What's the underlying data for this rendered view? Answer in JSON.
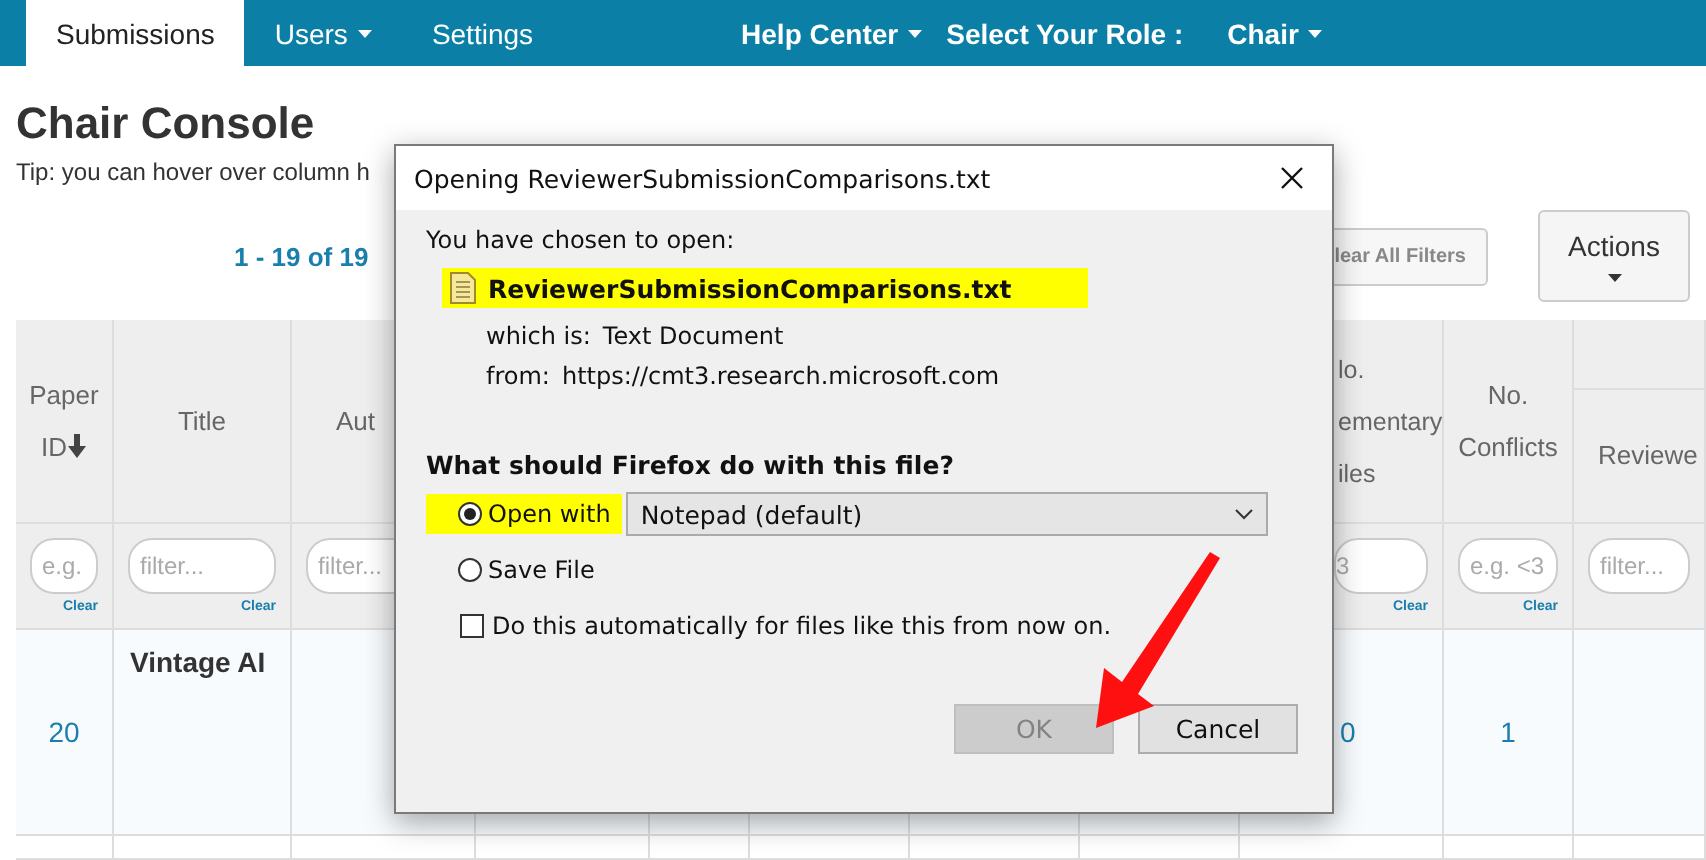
{
  "nav": {
    "items": [
      {
        "label": "Submissions",
        "selected": true,
        "dropdown": false
      },
      {
        "label": "Users",
        "selected": false,
        "dropdown": true
      },
      {
        "label": "Settings",
        "selected": false,
        "dropdown": false
      }
    ],
    "right_items": [
      {
        "label": "Help Center",
        "dropdown": true
      },
      {
        "label": "Select Your Role :",
        "dropdown": false
      },
      {
        "label": "Chair",
        "dropdown": true
      }
    ]
  },
  "page": {
    "title": "Chair Console",
    "tip": "Tip: you can hover over column h",
    "pagination": "1 - 19 of 19",
    "clear_filters_button": "lear All Filters",
    "actions_button": "Actions"
  },
  "table": {
    "columns": [
      {
        "header": [
          "Paper",
          "ID"
        ],
        "sorted": true,
        "filter": {
          "placeholder": "e.g.",
          "clear": "Clear"
        }
      },
      {
        "header": [
          "Title"
        ],
        "sorted": false,
        "filter": {
          "placeholder": "filter...",
          "clear": "Clear"
        }
      },
      {
        "header": [
          "Aut"
        ],
        "sorted": false,
        "filter": {
          "placeholder": "filter..."
        }
      },
      {
        "header": [
          "lo.",
          "ementary",
          "iles"
        ],
        "sorted": false,
        "filter": {
          "placeholder": "3",
          "clear": "Clear"
        }
      },
      {
        "header": [
          "No.",
          "Conflicts"
        ],
        "sorted": false,
        "filter": {
          "placeholder": "e.g. <3",
          "clear": "Clear"
        }
      },
      {
        "header": [
          "Reviewe"
        ],
        "sorted": false,
        "filter": {
          "placeholder": "filter..."
        }
      }
    ],
    "rows": [
      {
        "paper_id": "20",
        "title": "Vintage AI",
        "supplementary_files": "0",
        "conflicts": "1"
      }
    ]
  },
  "dialog": {
    "title": "Opening ReviewerSubmissionComparisons.txt",
    "intro": "You have chosen to open:",
    "file_name": "ReviewerSubmissionComparisons.txt",
    "file_highlighted": true,
    "type_label": "which is:",
    "type_value": "Text Document",
    "source_label": "from:",
    "source_value": "https://cmt3.research.microsoft.com",
    "question": "What should Firefox do with this file?",
    "options": [
      {
        "label": "Open with",
        "selected": true,
        "highlighted": true,
        "app": "Notepad (default)"
      },
      {
        "label": "Save File",
        "selected": false,
        "highlighted": false
      }
    ],
    "remember": {
      "label": "Do this automatically for files like this from now on.",
      "checked": false
    },
    "buttons": [
      {
        "label": "OK",
        "disabled": true
      },
      {
        "label": "Cancel",
        "disabled": false
      }
    ]
  }
}
